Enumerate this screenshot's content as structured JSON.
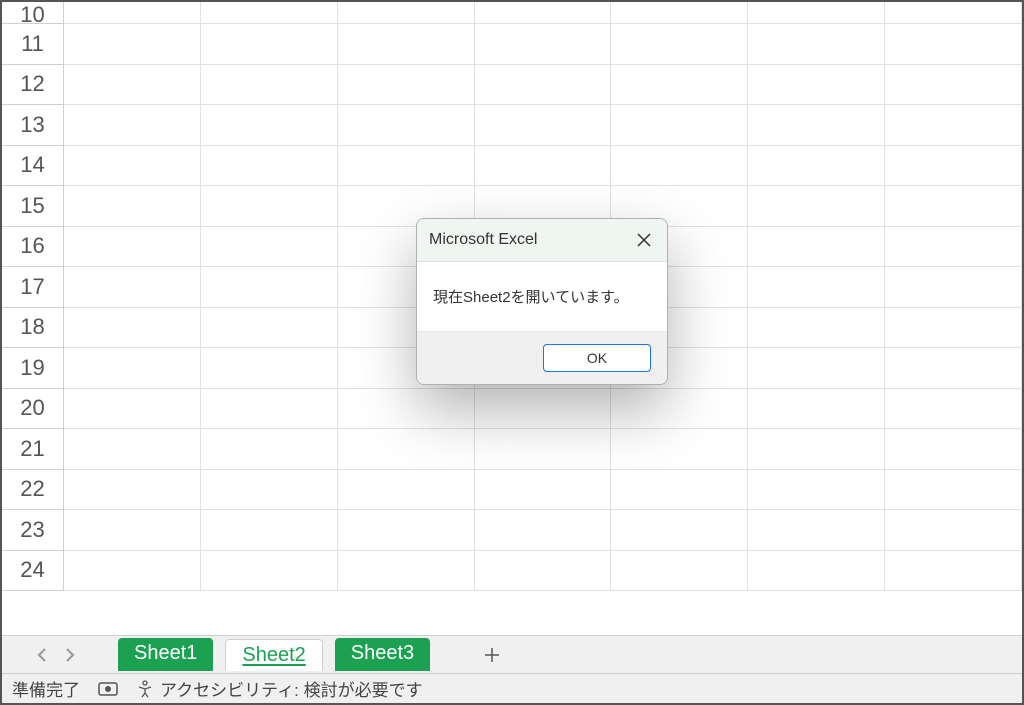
{
  "row_numbers": [
    "10",
    "11",
    "12",
    "13",
    "14",
    "15",
    "16",
    "17",
    "18",
    "19",
    "20",
    "21",
    "22",
    "23",
    "24"
  ],
  "dialog": {
    "title": "Microsoft Excel",
    "message": "現在Sheet2を開いています。",
    "ok_label": "OK"
  },
  "sheets": {
    "tabs": [
      "Sheet1",
      "Sheet2",
      "Sheet3"
    ],
    "active_index": 1
  },
  "status": {
    "ready": "準備完了",
    "accessibility": "アクセシビリティ: 検討が必要です"
  }
}
